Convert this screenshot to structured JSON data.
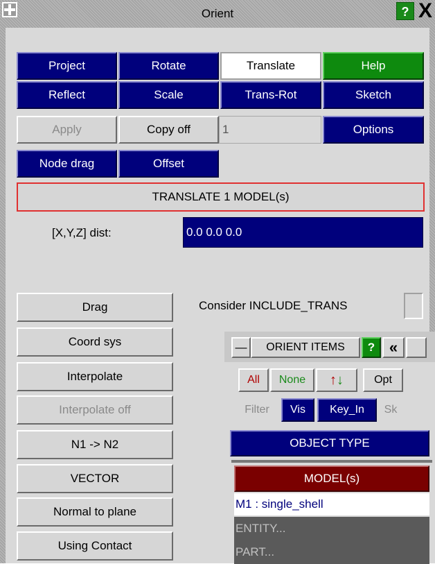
{
  "window": {
    "title": "Orient",
    "help_label": "?",
    "close_label": "X"
  },
  "toolbar": {
    "row1": [
      "Project",
      "Rotate",
      "Translate",
      "Help"
    ],
    "row2": [
      "Reflect",
      "Scale",
      "Trans-Rot",
      "Sketch"
    ]
  },
  "apply_row": {
    "apply": "Apply",
    "copy": "Copy off",
    "copy_count": "1",
    "options": "Options"
  },
  "mode_row": {
    "node_drag": "Node drag",
    "offset": "Offset"
  },
  "banner": "TRANSLATE 1 MODEL(s)",
  "dist": {
    "label": "[X,Y,Z] dist:",
    "value": "0.0  0.0  0.0"
  },
  "side_buttons": [
    "Drag",
    "Coord sys",
    "Interpolate",
    "Interpolate off",
    "N1 -> N2",
    "VECTOR",
    "Normal to plane",
    "Using Contact"
  ],
  "include_trans": "Consider INCLUDE_TRANS",
  "orient_items": {
    "title": "ORIENT ITEMS",
    "help": "?",
    "collapse": "«",
    "minimize": "—",
    "all": "All",
    "none": "None",
    "swap_up": "↑",
    "swap_down": "↓",
    "opt": "Opt",
    "filter": "Filter",
    "vis": "Vis",
    "key_in": "Key_In",
    "sk": "Sk",
    "object_type": "OBJECT TYPE",
    "model_header": "MODEL(s)",
    "model_item": "M1 : single_shell",
    "entity": "ENTITY...",
    "part": "PART..."
  },
  "colors": {
    "blue": "#00007c",
    "green": "#0e8a0e",
    "maroon": "#7a0000"
  }
}
